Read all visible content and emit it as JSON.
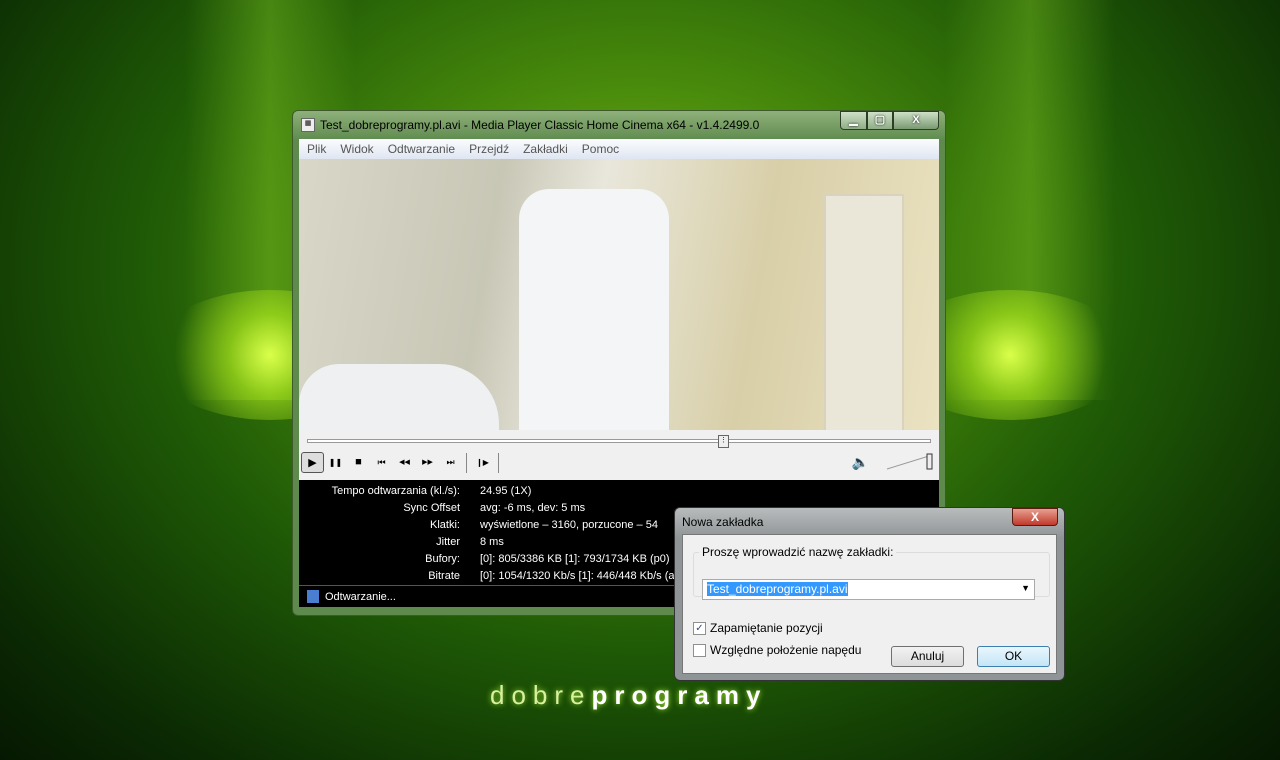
{
  "window": {
    "title": "Test_dobreprogramy.pl.avi - Media Player Classic Home Cinema x64 - v1.4.2499.0",
    "minimize": "▁",
    "maximize": "▢",
    "close": "X"
  },
  "menu": [
    "Plik",
    "Widok",
    "Odtwarzanie",
    "Przejdź",
    "Zakładki",
    "Pomoc"
  ],
  "playback": {
    "seek_fraction": 0.67,
    "volume_fraction": 1.0
  },
  "controls": {
    "play": "▶",
    "pause": "❚❚",
    "stop": "■",
    "prev": "⏮",
    "rew": "◀◀",
    "fwd": "▶▶",
    "next": "⏭",
    "frame_step": "❙▶",
    "volume": "🔈"
  },
  "stats": [
    {
      "k": "Tempo odtwarzania (kl./s):",
      "v": "24.95 (1X)"
    },
    {
      "k": "Sync Offset",
      "v": "avg: -6 ms, dev: 5 ms"
    },
    {
      "k": "Klatki:",
      "v": "wyświetlone – 3160, porzucone – 54"
    },
    {
      "k": "Jitter",
      "v": "8 ms"
    },
    {
      "k": "Bufory:",
      "v": "[0]: 805/3386 KB [1]: 793/1734 KB (p0)"
    },
    {
      "k": "Bitrate",
      "v": "[0]: 1054/1320 Kb/s [1]: 446/448 Kb/s (a"
    }
  ],
  "status": "Odtwarzanie...",
  "dialog": {
    "title": "Nowa zakładka",
    "close": "X",
    "group_label": "Proszę wprowadzić nazwę zakładki:",
    "name_value": "Test_dobreprogramy.pl.avi",
    "remember_label": "Zapamiętanie pozycji",
    "remember_checked": true,
    "relative_label": "Względne położenie napędu",
    "relative_checked": false,
    "cancel": "Anuluj",
    "ok": "OK"
  },
  "logo": {
    "light": "dobre",
    "bold": "programy"
  }
}
